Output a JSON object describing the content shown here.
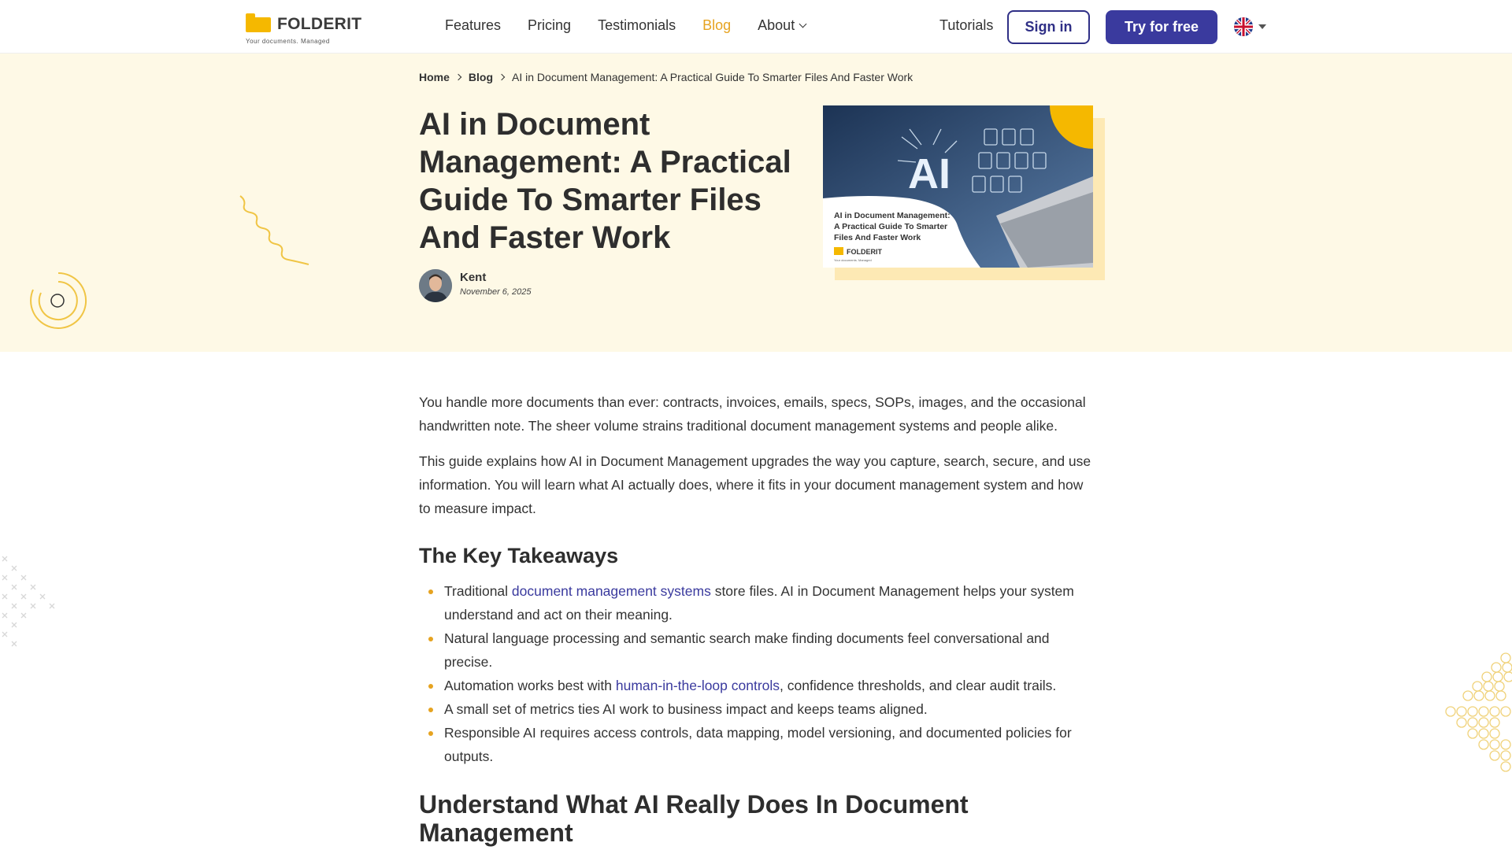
{
  "brand": {
    "name": "FOLDERIT",
    "tagline": "Your documents. Managed",
    "accent": "#f5b800"
  },
  "nav": {
    "items": [
      {
        "label": "Features"
      },
      {
        "label": "Pricing"
      },
      {
        "label": "Testimonials"
      },
      {
        "label": "Blog"
      },
      {
        "label": "About"
      }
    ],
    "active": "Blog",
    "tutorials": "Tutorials",
    "sign_in": "Sign in",
    "try_free": "Try for free",
    "language_icon": "uk-flag-icon"
  },
  "breadcrumb": {
    "home": "Home",
    "blog": "Blog",
    "current": "AI in Document Management: A Practical Guide To Smarter Files And Faster Work"
  },
  "article": {
    "title": "AI in Document Management: A Practical Guide To Smarter Files And Faster Work",
    "author": "Kent",
    "date": "November 6, 2025",
    "image": {
      "badge": "AI",
      "caption": "AI in Document Management: A Practical Guide To Smarter Files And Faster Work",
      "brand": "FOLDERIT",
      "tagline": "Your documents. Managed"
    },
    "intro1": "You handle more documents than ever: contracts, invoices, emails, specs, SOPs, images, and the occasional handwritten note. The sheer volume strains traditional document management systems and people alike.",
    "intro2": "This guide explains how AI in Document Management upgrades the way you capture, search, secure, and use information. You will learn what AI actually does, where it fits in your document management system and how to measure impact.",
    "takeaways_heading": "The Key Takeaways",
    "takeaways": {
      "t1_pre": "Traditional ",
      "t1_link": "document management systems",
      "t1_post": " store files. AI in Document Management helps your system understand and act on their meaning.",
      "t2": "Natural language processing and semantic search make finding documents feel conversational and precise.",
      "t3_pre": "Automation works best with ",
      "t3_link": "human-in-the-loop controls",
      "t3_post": ", confidence thresholds, and clear audit trails.",
      "t4": "A small set of metrics ties AI work to business impact and keeps teams aligned.",
      "t5": "Responsible AI requires access controls, data mapping, model versioning, and documented policies for outputs."
    },
    "next_heading": "Understand What AI Really Does In Document Management"
  },
  "colors": {
    "primary": "#3a3a9e",
    "hero_bg": "#fef9e6",
    "active_link": "#e6a320"
  }
}
